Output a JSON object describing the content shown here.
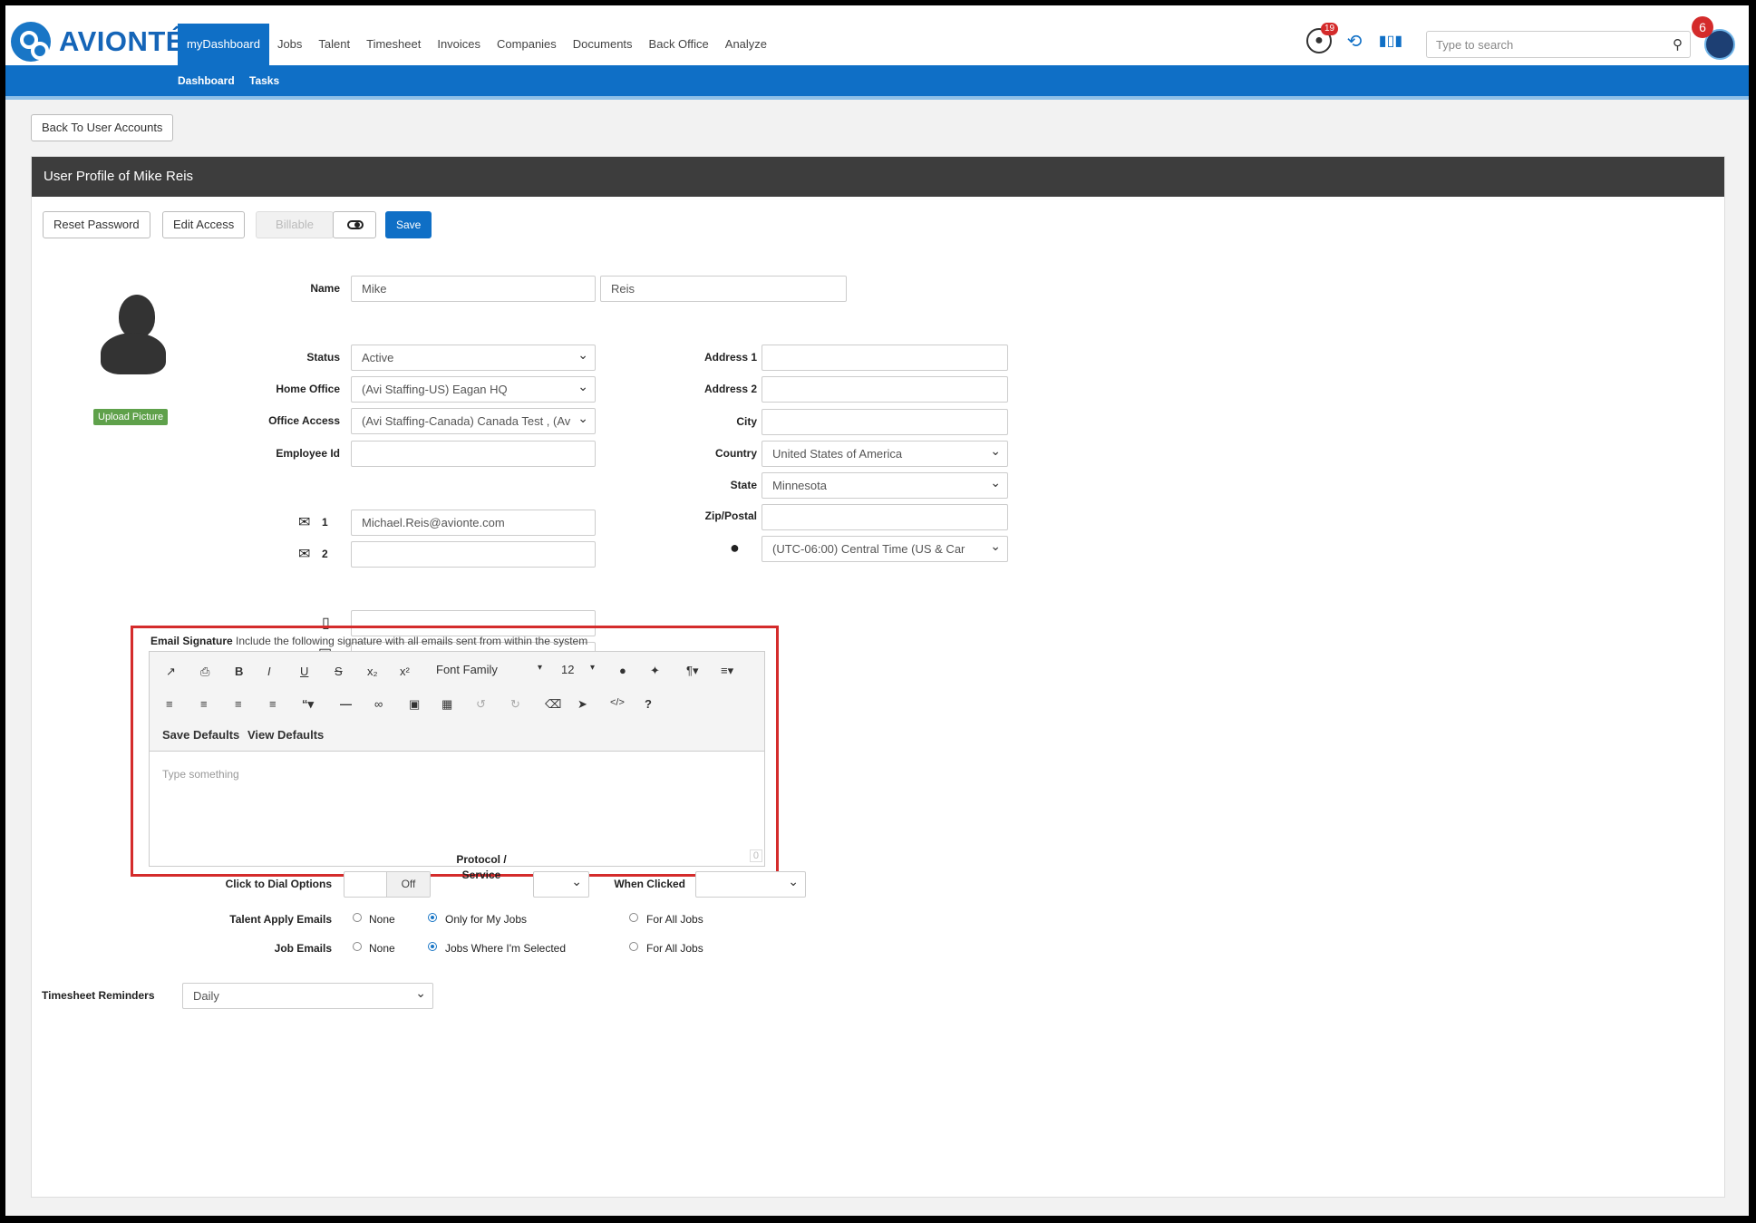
{
  "app": {
    "brand": "AVIONTÉ"
  },
  "nav": {
    "items": [
      "myDashboard",
      "Jobs",
      "Talent",
      "Timesheet",
      "Invoices",
      "Companies",
      "Documents",
      "Back Office",
      "Analyze"
    ]
  },
  "header": {
    "notif_count": "19",
    "search_placeholder": "Type to search",
    "avatar_badge": "6"
  },
  "subnav": {
    "items": [
      "Dashboard",
      "Tasks"
    ]
  },
  "back_button": "Back To User Accounts",
  "panel": {
    "title": "User Profile of Mike Reis"
  },
  "actions": {
    "reset_password": "Reset Password",
    "edit_access": "Edit Access",
    "billable": "Billable",
    "save": "Save"
  },
  "profile": {
    "upload_label": "Upload Picture",
    "name_label": "Name",
    "first_name": "Mike",
    "last_name": "Reis",
    "status_label": "Status",
    "status": "Active",
    "home_office_label": "Home Office",
    "home_office": "(Avi Staffing-US) Eagan HQ",
    "office_access_label": "Office Access",
    "office_access": "(Avi Staffing-Canada) Canada Test , (Av",
    "employee_id_label": "Employee Id",
    "employee_id": "",
    "email1_num": "1",
    "email1": "Michael.Reis@avionte.com",
    "email2_num": "2",
    "email2": ""
  },
  "address": {
    "address1_label": "Address 1",
    "address2_label": "Address 2",
    "city_label": "City",
    "country_label": "Country",
    "country": "United States of America",
    "state_label": "State",
    "state": "Minnesota",
    "zip_label": "Zip/Postal",
    "timezone": "(UTC-06:00) Central Time (US & Car"
  },
  "signature": {
    "label_bold": "Email Signature",
    "label_rest": "Include the following signature with all emails sent from within the system",
    "font_family": "Font Family",
    "font_size": "12",
    "save_defaults": "Save Defaults",
    "view_defaults": "View Defaults",
    "placeholder": "Type something",
    "count": "0"
  },
  "dial": {
    "label": "Click to Dial Options",
    "toggle": "Off",
    "protocol_label": "Protocol /",
    "protocol_label2": "Service",
    "when_clicked_label": "When Clicked"
  },
  "talent_apply": {
    "label": "Talent Apply Emails",
    "none": "None",
    "mine": "Only for My Jobs",
    "all": "For All Jobs"
  },
  "job_emails": {
    "label": "Job Emails",
    "none": "None",
    "selected": "Jobs Where I'm Selected",
    "all": "For All Jobs"
  },
  "timesheet": {
    "label": "Timesheet Reminders",
    "value": "Daily"
  }
}
